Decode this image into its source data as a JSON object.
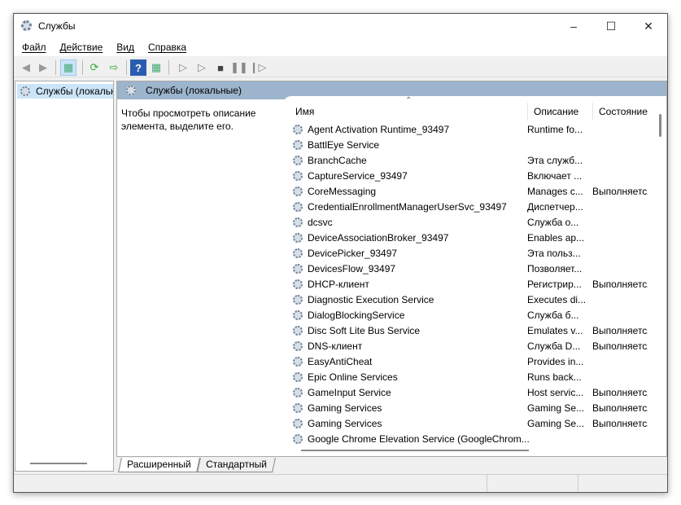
{
  "window": {
    "title": "Службы"
  },
  "menu": [
    "Файл",
    "Действие",
    "Вид",
    "Справка"
  ],
  "left_tree": {
    "selected": "Службы (локальные)"
  },
  "header_band": "Службы (локальные)",
  "description_hint": "Чтобы просмотреть описание элемента, выделите его.",
  "columns": [
    "Имя",
    "Описание",
    "Состояние"
  ],
  "services": [
    {
      "name": "Agent Activation Runtime_93497",
      "desc": "Runtime fo...",
      "status": ""
    },
    {
      "name": "BattlEye Service",
      "desc": "",
      "status": ""
    },
    {
      "name": "BranchCache",
      "desc": "Эта служб...",
      "status": ""
    },
    {
      "name": "CaptureService_93497",
      "desc": "Включает ...",
      "status": ""
    },
    {
      "name": "CoreMessaging",
      "desc": "Manages c...",
      "status": "Выполняется"
    },
    {
      "name": "CredentialEnrollmentManagerUserSvc_93497",
      "desc": "Диспетчер...",
      "status": ""
    },
    {
      "name": "dcsvc",
      "desc": "Служба о...",
      "status": ""
    },
    {
      "name": "DeviceAssociationBroker_93497",
      "desc": "Enables ap...",
      "status": ""
    },
    {
      "name": "DevicePicker_93497",
      "desc": "Эта польз...",
      "status": ""
    },
    {
      "name": "DevicesFlow_93497",
      "desc": "Позволяет...",
      "status": ""
    },
    {
      "name": "DHCP-клиент",
      "desc": "Регистрир...",
      "status": "Выполняется"
    },
    {
      "name": "Diagnostic Execution Service",
      "desc": "Executes di...",
      "status": ""
    },
    {
      "name": "DialogBlockingService",
      "desc": "Служба б...",
      "status": ""
    },
    {
      "name": "Disc Soft Lite Bus Service",
      "desc": "Emulates v...",
      "status": "Выполняется"
    },
    {
      "name": "DNS-клиент",
      "desc": "Служба D...",
      "status": "Выполняется"
    },
    {
      "name": "EasyAntiCheat",
      "desc": "Provides in...",
      "status": ""
    },
    {
      "name": "Epic Online Services",
      "desc": "Runs back...",
      "status": ""
    },
    {
      "name": "GameInput Service",
      "desc": "Host servic...",
      "status": "Выполняется"
    },
    {
      "name": "Gaming Services",
      "desc": "Gaming Se...",
      "status": "Выполняется"
    },
    {
      "name": "Gaming Services",
      "desc": "Gaming Se...",
      "status": "Выполняется"
    },
    {
      "name": "Google Chrome Elevation Service (GoogleChrom...",
      "desc": "",
      "status": ""
    }
  ],
  "tabs": [
    "Расширенный",
    "Стандартный"
  ]
}
